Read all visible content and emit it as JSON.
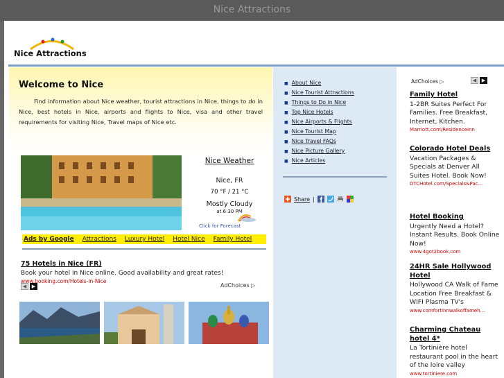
{
  "window": {
    "title": "Nice Attractions"
  },
  "logo": {
    "text": "Nice Attractions"
  },
  "welcome": {
    "title": "Welcome to Nice",
    "text": "Find information about Nice weather, tourist attractions in Nice, things to do in Nice, best hotels in Nice, airports and flights to Nice, visa and other travel requirements for visiting Nice, Travel maps of Nice etc."
  },
  "weather": {
    "title": "Nice Weather",
    "city": "Nice, FR",
    "temp": "70 °F / 21 °C",
    "condition": "Mostly Cloudy",
    "time": "at 6:30 PM",
    "forecast_link": "Click for Forecast"
  },
  "adsbar": [
    "Ads by Google",
    "Attractions",
    "Luxury Hotel",
    "Hotel Nice",
    "Family Hotel"
  ],
  "ad75": {
    "title": "75 Hotels in Nice (FR)",
    "desc": "Book your hotel in Nice online. Good availability and great rates!",
    "url": "www.booking.com/Hotels-in-Nice"
  },
  "adchoices": "AdChoices",
  "nav": [
    "About Nice",
    "Nice Tourist Attractions",
    "Things to Do in Nice",
    "Top Nice Hotels",
    "Nice Airports & Flights",
    "Nice Tourist Map",
    "Nice Travel FAQs",
    "Nice Picture Gallery",
    "Nice Articles"
  ],
  "share": {
    "label": "Share",
    "sep": "|"
  },
  "right_ads": [
    {
      "title": "Family Hotel",
      "body": "1-2BR Suites Perfect For Families. Free Breakfast, Internet, Kitchen.",
      "url": "Marriott.com/ResidenceInn"
    },
    {
      "title": "Colorado Hotel Deals",
      "body": "Vacation Packages & Specials at Denver All Suites Hotel. Book Now!",
      "url": "DTCHotel.com/Specials&Pac..."
    },
    {
      "title": "Hotel Booking",
      "body": "Urgently Need a Hotel? Instant Results. Book Online Now!",
      "url": "www.4got2book.com"
    },
    {
      "title": "24HR Sale Hollywood Hotel",
      "body": "Hollywood CA Walk of Fame Location Free Breakfast & WIFI Plasma TV's",
      "url": "www.comfortinnwalkoffameh..."
    },
    {
      "title": "Charming Chateau hotel 4*",
      "body": "La Tortinière hotel restaurant pool in the heart of the loire valley",
      "url": "www.tortiniere.com"
    }
  ],
  "colors": {
    "accent_yellow": "#ffee00",
    "nav_bg": "#dde9f4",
    "rule_blue": "#7aa0c8",
    "url_red": "#cc0000"
  },
  "icons": [
    "left-arrow-icon",
    "right-arrow-icon",
    "adchoices-icon",
    "share-plus-icon",
    "facebook-icon",
    "twitter-icon",
    "print-icon",
    "bookmark-icon",
    "cloud-sun-icon"
  ]
}
